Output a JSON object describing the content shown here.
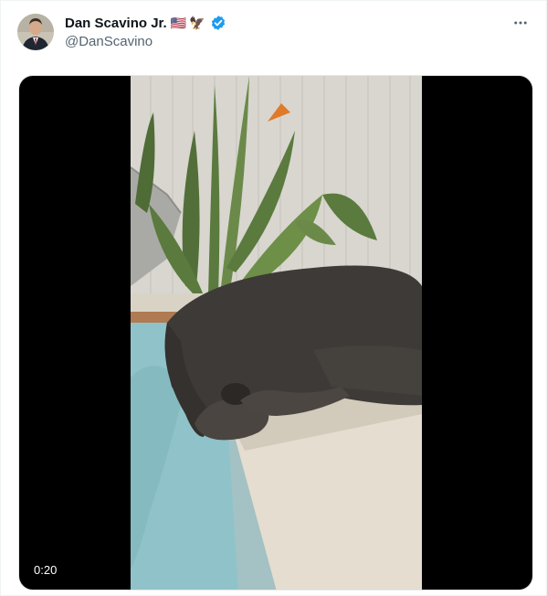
{
  "tweet": {
    "author": {
      "display_name": "Dan Scavino Jr.",
      "handle": "@DanScavino",
      "name_emojis": [
        "🇺🇸",
        "🦅"
      ],
      "verified": true,
      "verified_color": "#1d9bf0",
      "avatar_icon": "portrait-avatar"
    },
    "more_icon": "ellipsis-icon",
    "media": {
      "type": "video",
      "duration": "0:20",
      "thumbnail_description_icon": "sleeping-dog-by-pool-image"
    }
  },
  "colors": {
    "text_primary": "#0f1419",
    "text_secondary": "#536471",
    "pool_water": "#8fc3c9",
    "dog_fur": "#3d3a37"
  }
}
